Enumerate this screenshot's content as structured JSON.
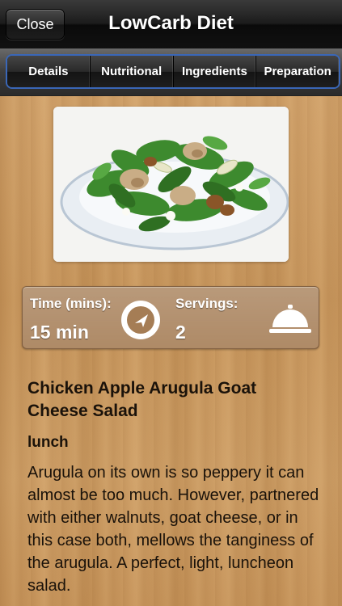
{
  "header": {
    "close_label": "Close",
    "title": "LowCarb Diet"
  },
  "tabs": [
    {
      "label": "Details"
    },
    {
      "label": "Nutritional"
    },
    {
      "label": "Ingredients"
    },
    {
      "label": "Preparation"
    }
  ],
  "info": {
    "time_label": "Time (mins):",
    "time_value": "15 min",
    "servings_label": "Servings:",
    "servings_value": "2",
    "time_icon": "clock-icon",
    "servings_icon": "serving-bell-icon"
  },
  "recipe": {
    "title": "Chicken Apple Arugula Goat Cheese Salad",
    "category": "lunch",
    "description": "Arugula on its own is so peppery it can almost be too much. However, partnered with either walnuts, goat cheese, or in this case both, mellows the tanginess of the arugula. A perfect, light, luncheon salad."
  },
  "colors": {
    "tab_border": "#3a67b8",
    "wood": "#c99a5e"
  }
}
